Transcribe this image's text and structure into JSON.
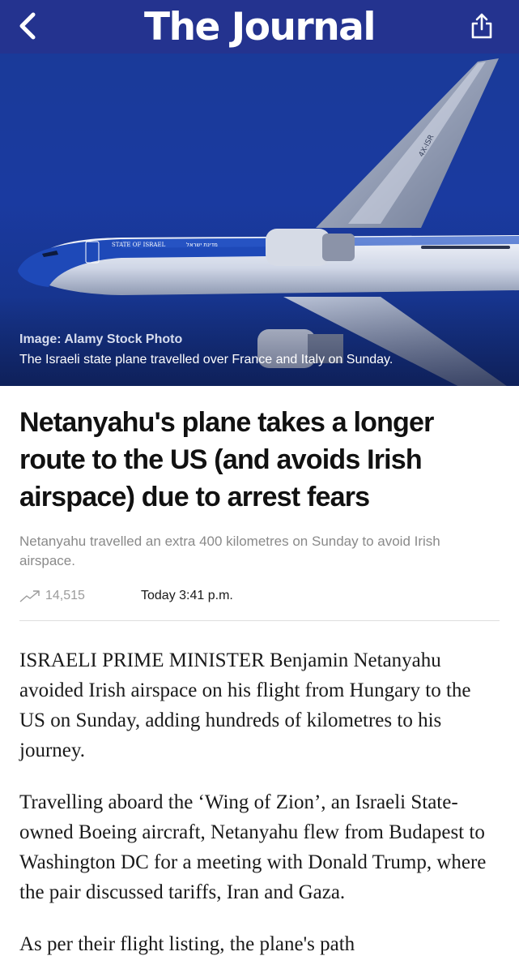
{
  "header": {
    "brand": "The Journal",
    "back_icon": "chevron-left-icon",
    "share_icon": "share-icon",
    "bar_color": "#24338f"
  },
  "hero": {
    "credit": "Image: Alamy Stock Photo",
    "caption": "The Israeli state plane travelled over France and Italy on Sunday.",
    "livery_text": "STATE OF ISRAEL",
    "livery_hebrew": "מדינת ישראל",
    "tail_reg": "4X-ISR"
  },
  "article": {
    "headline": "Netanyahu's plane takes a longer route to the US (and avoids Irish airspace) due to arrest fears",
    "standfirst": "Netanyahu travelled an extra 400 kilometres on Sunday to avoid Irish airspace.",
    "views": "14,515",
    "views_icon": "trending-up-icon",
    "published": "Today 3:41 p.m.",
    "paragraphs": [
      "ISRAELI PRIME MINISTER Benjamin Netanyahu avoided Irish airspace on his flight from Hungary to the US on Sunday, adding hundreds of kilometres to his journey.",
      "Travelling aboard the ‘Wing of Zion’, an Israeli State-owned Boeing aircraft, Netanyahu flew from Budapest to Washington DC for a meeting with Donald Trump, where the pair discussed tariffs, Iran and Gaza.",
      "As per their flight listing, the plane's path"
    ]
  }
}
